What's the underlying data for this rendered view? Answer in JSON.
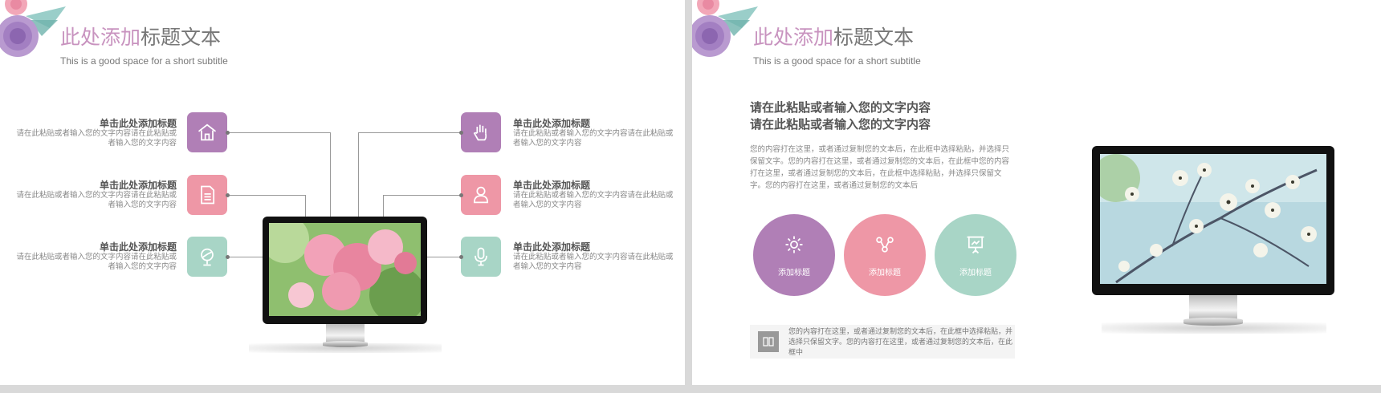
{
  "left_slide": {
    "title_accent": "此处添加",
    "title_rest": "标题文本",
    "subtitle": "This is a good  space  for a short subtitle",
    "left_items": [
      {
        "title": "单击此处添加标题",
        "body": "请在此粘贴或者输入您的文字内容请在此粘贴或者输入您的文字内容",
        "icon": "home-icon",
        "color": "#b07fb6"
      },
      {
        "title": "单击此处添加标题",
        "body": "请在此粘贴或者输入您的文字内容请在此粘贴或者输入您的文字内容",
        "icon": "document-icon",
        "color": "#ee97a6"
      },
      {
        "title": "单击此处添加标题",
        "body": "请在此粘贴或者输入您的文字内容请在此粘贴或者输入您的文字内容",
        "icon": "globe-icon",
        "color": "#a8d5c6"
      }
    ],
    "right_items": [
      {
        "title": "单击此处添加标题",
        "body": "请在此粘贴或者输入您的文字内容请在此粘贴或者输入您的文字内容",
        "icon": "hand-icon",
        "color": "#b07fb6"
      },
      {
        "title": "单击此处添加标题",
        "body": "请在此粘贴或者输入您的文字内容请在此粘贴或者输入您的文字内容",
        "icon": "user-icon",
        "color": "#ee97a6"
      },
      {
        "title": "单击此处添加标题",
        "body": "请在此粘贴或者输入您的文字内容请在此粘贴或者输入您的文字内容",
        "icon": "microphone-icon",
        "color": "#a8d5c6"
      }
    ]
  },
  "right_slide": {
    "title_accent": "此处添加",
    "title_rest": "标题文本",
    "subtitle": "This is a good  space  for a short subtitle",
    "heading_lines": [
      "请在此粘贴或者输入您的文字内容",
      "请在此粘贴或者输入您的文字内容"
    ],
    "paragraph": "您的内容打在这里，或者通过复制您的文本后，在此框中选择粘贴，并选择只保留文字。您的内容打在这里，或者通过复制您的文本后，在此框中您的内容打在这里，或者通过复制您的文本后，在此框中选择粘贴，并选择只保留文字。您的内容打在这里，或者通过复制您的文本后",
    "circles": [
      {
        "label": "添加标题",
        "icon": "gear-icon",
        "color": "#b07fb6"
      },
      {
        "label": "添加标题",
        "icon": "share-icon",
        "color": "#ee97a6"
      },
      {
        "label": "添加标题",
        "icon": "presentation-icon",
        "color": "#a8d5c6"
      }
    ],
    "note": "您的内容打在这里，或者通过复制您的文本后，在此框中选择粘贴，并选择只保留文字。您的内容打在这里，或者通过复制您的文本后，在此框中"
  }
}
